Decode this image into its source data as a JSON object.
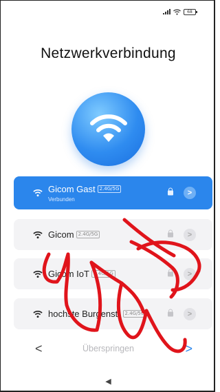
{
  "status_bar": {
    "battery": "68",
    "icons": [
      "signal-icon",
      "wifi-icon",
      "battery-icon"
    ]
  },
  "page": {
    "title": "Netzwerkverbindung"
  },
  "hero": {
    "icon": "wifi-icon",
    "color": "#2f8cf0"
  },
  "networks": [
    {
      "name": "Gicom Gast",
      "band": "2.4G/5G",
      "status": "Verbunden",
      "secured": true,
      "active": true
    },
    {
      "name": "Gicom",
      "band": "2.4G/5G",
      "status": "",
      "secured": true,
      "active": false
    },
    {
      "name": "Gicom IoT",
      "band": "2.4G/5G",
      "status": "",
      "secured": true,
      "active": false
    },
    {
      "name": "hochste Burgenstr",
      "band": "2.4G/5G",
      "status": "",
      "secured": true,
      "active": false
    }
  ],
  "footer": {
    "back_label": "<",
    "skip_label": "Überspringen",
    "next_label": ">"
  },
  "system_nav": {
    "back_label": "◀"
  },
  "colors": {
    "accent": "#2b86ec",
    "scribble": "#e0141b"
  }
}
